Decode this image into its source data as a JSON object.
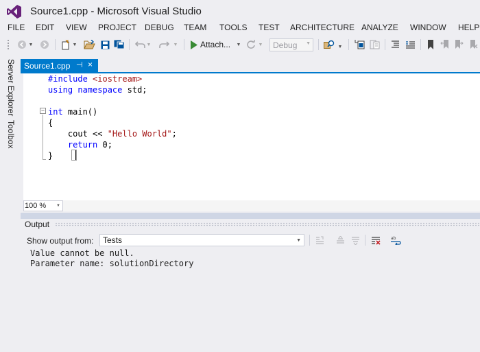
{
  "window": {
    "title": "Source1.cpp - Microsoft Visual Studio"
  },
  "menu": [
    "FILE",
    "EDIT",
    "VIEW",
    "PROJECT",
    "DEBUG",
    "TEAM",
    "TOOLS",
    "TEST",
    "ARCHITECTURE",
    "ANALYZE",
    "WINDOW",
    "HELP"
  ],
  "toolbar": {
    "attach_label": "Attach...",
    "config_value": "Debug"
  },
  "side_tabs": {
    "server_explorer": "Server Explorer",
    "toolbox": "Toolbox"
  },
  "doc_tab": {
    "label": "Source1.cpp",
    "pin": "⊣",
    "close": "×"
  },
  "code_lines": [
    "#include <iostream>",
    "using namespace std;",
    "",
    "int main()",
    "{",
    "    cout << \"Hello World\";",
    "    return 0;",
    "}"
  ],
  "editor": {
    "zoom": "100 %"
  },
  "output": {
    "title": "Output",
    "show_from_label": "Show output from:",
    "source": "Tests",
    "lines": [
      "Value cannot be null.",
      "Parameter name: solutionDirectory"
    ]
  }
}
